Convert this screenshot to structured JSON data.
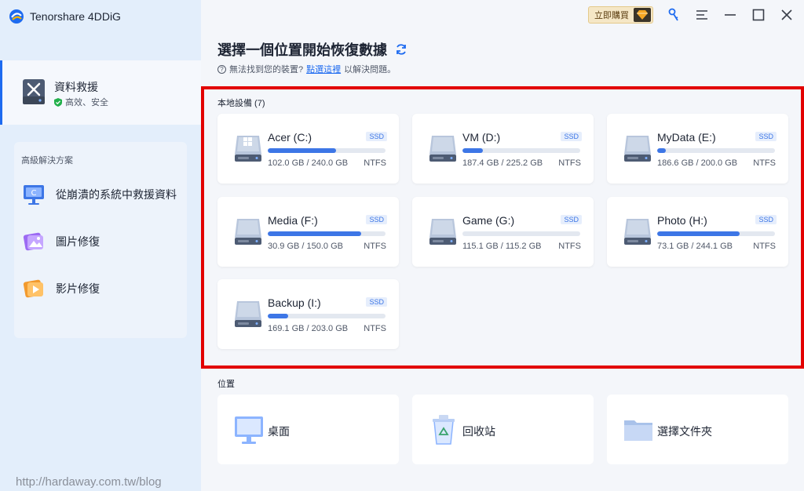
{
  "app": {
    "title": "Tenorshare 4DDiG"
  },
  "sidebar": {
    "active": {
      "title": "資料救援",
      "subtitle": "高效、安全"
    },
    "advanced": {
      "title": "高級解決方案",
      "items": [
        {
          "label": "從崩潰的系統中救援資料"
        },
        {
          "label": "圖片修復"
        },
        {
          "label": "影片修復"
        }
      ]
    }
  },
  "topbar": {
    "buy_label": "立即購買"
  },
  "main": {
    "title": "選擇一個位置開始恢復數據",
    "help_prefix": "無法找到您的裝置?",
    "help_link": "點選這裡",
    "help_suffix": "以解決問題。",
    "local_label": "本地設備 (7)",
    "location_label": "位置"
  },
  "drives": [
    {
      "name": "Acer (C:)",
      "badge": "SSD",
      "size": "102.0 GB / 240.0 GB",
      "fs": "NTFS",
      "used": 0.58,
      "windows": true
    },
    {
      "name": "VM (D:)",
      "badge": "SSD",
      "size": "187.4 GB / 225.2 GB",
      "fs": "NTFS",
      "used": 0.17
    },
    {
      "name": "MyData (E:)",
      "badge": "SSD",
      "size": "186.6 GB / 200.0 GB",
      "fs": "NTFS",
      "used": 0.07
    },
    {
      "name": "Media (F:)",
      "badge": "SSD",
      "size": "30.9 GB / 150.0 GB",
      "fs": "NTFS",
      "used": 0.79
    },
    {
      "name": "Game (G:)",
      "badge": "SSD",
      "size": "115.1 GB / 115.2 GB",
      "fs": "NTFS",
      "used": 0.0
    },
    {
      "name": "Photo (H:)",
      "badge": "SSD",
      "size": "73.1 GB / 244.1 GB",
      "fs": "NTFS",
      "used": 0.7
    },
    {
      "name": "Backup (I:)",
      "badge": "SSD",
      "size": "169.1 GB / 203.0 GB",
      "fs": "NTFS",
      "used": 0.17
    }
  ],
  "locations": [
    {
      "label": "桌面",
      "icon": "monitor-icon"
    },
    {
      "label": "回收站",
      "icon": "recycle-bin-icon"
    },
    {
      "label": "選擇文件夾",
      "icon": "folder-icon"
    }
  ],
  "watermark": "http://hardaway.com.tw/blog",
  "colors": {
    "accent": "#3d76e6",
    "highlight": "#e20000",
    "sidebar": "#e3eefb"
  }
}
